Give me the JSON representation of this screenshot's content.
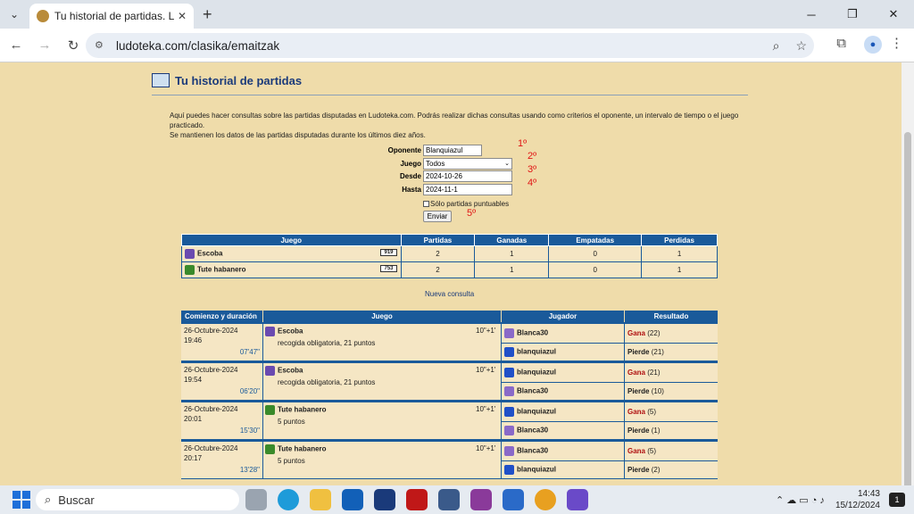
{
  "browser": {
    "tab_title": "Tu historial de partidas. Ludotek",
    "url": "ludoteka.com/clasika/emaitzak"
  },
  "page": {
    "title": "Tu historial de partidas",
    "intro1": "Aquí puedes hacer consultas sobre las partidas disputadas en Ludoteka.com. Podrás realizar dichas consultas usando como criterios el oponente, un intervalo de tiempo o el juego practicado.",
    "intro2": "Se mantienen los datos de las partidas disputadas durante los últimos diez años.",
    "form": {
      "oponente_label": "Oponente",
      "oponente_value": "Blanquiazul",
      "juego_label": "Juego",
      "juego_value": "Todos",
      "desde_label": "Desde",
      "desde_value": "2024-10-26",
      "hasta_label": "Hasta",
      "hasta_value": "2024-11-1",
      "checkbox_label": "Sólo partidas puntuables",
      "submit": "Enviar"
    },
    "annotations": [
      "1º",
      "2º",
      "3º",
      "4º",
      "5º"
    ],
    "summary": {
      "headers": [
        "Juego",
        "Partidas",
        "Ganadas",
        "Empatadas",
        "Perdidas"
      ],
      "rows": [
        {
          "game": "Escoba",
          "count": "919",
          "partidas": "2",
          "ganadas": "1",
          "empatadas": "0",
          "perdidas": "1"
        },
        {
          "game": "Tute habanero",
          "count": "753",
          "partidas": "2",
          "ganadas": "1",
          "empatadas": "0",
          "perdidas": "1"
        }
      ]
    },
    "nueva": "Nueva consulta",
    "history": {
      "headers": [
        "Comienzo y duración",
        "Juego",
        "Jugador",
        "Resultado"
      ],
      "blocks": [
        {
          "date": "26-Octubre-2024",
          "time": "19:46",
          "dur": "07'47\"",
          "game": "Escoba",
          "desc": "recogida obligatoria, 21 puntos",
          "tc": "10\"+1'",
          "p1": "Blanca30",
          "r1": "Gana",
          "s1": "(22)",
          "p2": "blanquiazul",
          "r2": "Pierde",
          "s2": "(21)"
        },
        {
          "date": "26-Octubre-2024",
          "time": "19:54",
          "dur": "06'20\"",
          "game": "Escoba",
          "desc": "recogida obligatoria, 21 puntos",
          "tc": "10\"+1'",
          "p1": "blanquiazul",
          "r1": "Gana",
          "s1": "(21)",
          "p2": "Blanca30",
          "r2": "Pierde",
          "s2": "(10)"
        },
        {
          "date": "26-Octubre-2024",
          "time": "20:01",
          "dur": "15'30\"",
          "game": "Tute habanero",
          "desc": "5 puntos",
          "tc": "10\"+1'",
          "p1": "blanquiazul",
          "r1": "Gana",
          "s1": "(5)",
          "p2": "Blanca30",
          "r2": "Pierde",
          "s2": "(1)"
        },
        {
          "date": "26-Octubre-2024",
          "time": "20:17",
          "dur": "13'28\"",
          "game": "Tute habanero",
          "desc": "5 puntos",
          "tc": "10\"+1'",
          "p1": "Blanca30",
          "r1": "Gana",
          "s1": "(5)",
          "p2": "blanquiazul",
          "r2": "Pierde",
          "s2": "(2)"
        }
      ]
    }
  },
  "taskbar": {
    "search": "Buscar",
    "time": "14:43",
    "date": "15/12/2024",
    "notif": "1"
  },
  "colors": {
    "page_bg": "#efdcaa",
    "header_blue": "#1a5a9a",
    "win_red": "#b01010"
  }
}
